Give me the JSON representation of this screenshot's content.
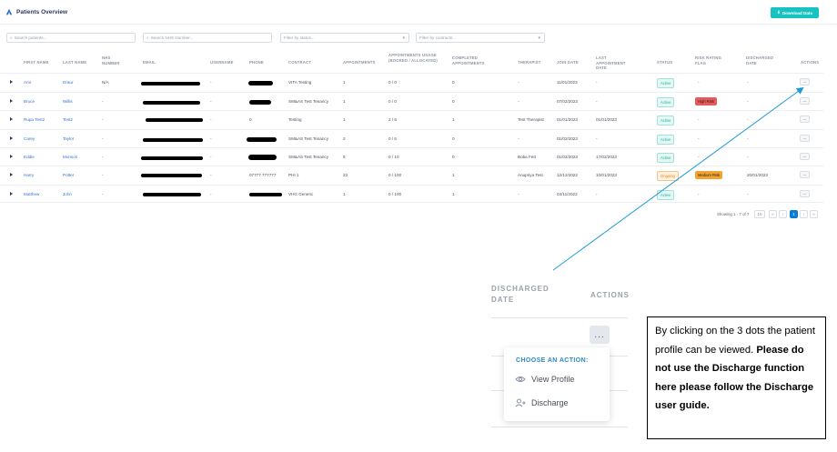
{
  "header": {
    "title": "Patients Overview",
    "download_label": "Download Data"
  },
  "filters": {
    "search_placeholder": "Search patients...",
    "nhs_placeholder": "Search NHS Number...",
    "status_placeholder": "Filter by status...",
    "contracts_placeholder": "Filter by contracts..."
  },
  "table": {
    "columns": {
      "first_name": "First Name",
      "last_name": "Last Name",
      "nhs_number": "NHS Number",
      "email": "Email",
      "username": "Username",
      "phone": "Phone",
      "contract": "Contract",
      "appointments": "Appointments",
      "appointments_usage": "Appointments Usage (Booked / Allocated)",
      "completed": "Completed Appointments",
      "therapist": "Therapist",
      "join_date": "Join Date",
      "last_appointment": "Last Appointment Date",
      "status": "Status",
      "risk_flag": "Risk Rating Flag",
      "discharged": "Discharged Date",
      "actions": "Actions"
    },
    "rows": [
      {
        "first": "Amr",
        "last": "Draur",
        "nhs": "N/A",
        "username": "-",
        "phone": "",
        "contract": "VITA Testing",
        "appts": "1",
        "usage": "0 / 0",
        "completed": "0",
        "therapist": "-",
        "join": "11/01/2023",
        "last_appt": "-",
        "status": "Active",
        "flag": "-",
        "discharged": "-",
        "actions": "..."
      },
      {
        "first": "Bruce",
        "last": "Willis",
        "nhs": "-",
        "username": "-",
        "phone": "",
        "contract": "SM&AS Test Tenancy",
        "appts": "1",
        "usage": "0 / 0",
        "completed": "0",
        "therapist": "-",
        "join": "07/02/2023",
        "last_appt": "-",
        "status": "Active",
        "flag": "High Risk",
        "discharged": "-",
        "actions": "..."
      },
      {
        "first": "Rupa Test2",
        "last": "Test2",
        "nhs": "-",
        "username": "-",
        "phone": "0",
        "contract": "Testing",
        "appts": "1",
        "usage": "2 / 6",
        "completed": "1",
        "therapist": "Test Therapist",
        "join": "01/01/2023",
        "last_appt": "01/01/2023",
        "status": "Active",
        "flag": "-",
        "discharged": "-",
        "actions": "..."
      },
      {
        "first": "Carey",
        "last": "Taylor",
        "nhs": "-",
        "username": "-",
        "phone": "",
        "contract": "SM&AS Test Tenancy",
        "appts": "2",
        "usage": "0 / 6",
        "completed": "0",
        "therapist": "-",
        "join": "01/02/2023",
        "last_appt": "-",
        "status": "Active",
        "flag": "-",
        "discharged": "-",
        "actions": "..."
      },
      {
        "first": "Eddie",
        "last": "Munson",
        "nhs": "-",
        "username": "-",
        "phone": "",
        "contract": "SM&AS Test Tenancy",
        "appts": "5",
        "usage": "0 / 10",
        "completed": "0",
        "therapist": "Boba Fett",
        "join": "01/02/2023",
        "last_appt": "17/02/2023",
        "status": "Active",
        "flag": "-",
        "discharged": "-",
        "actions": "..."
      },
      {
        "first": "Harry",
        "last": "Potter",
        "nhs": "-",
        "username": "-",
        "phone": "07777 777777",
        "contract": "PHI 1",
        "appts": "23",
        "usage": "0 / 100",
        "completed": "1",
        "therapist": "Anupriya Test",
        "join": "12/12/2022",
        "last_appt": "10/01/2023",
        "status": "Ongoing",
        "flag": "Medium Risk",
        "discharged": "20/01/2023",
        "actions": "..."
      },
      {
        "first": "Matthew",
        "last": "John",
        "nhs": "-",
        "username": "-",
        "phone": "",
        "contract": "VHG Generic",
        "appts": "1",
        "usage": "0 / 100",
        "completed": "1",
        "therapist": "-",
        "join": "04/11/2022",
        "last_appt": "-",
        "status": "Active",
        "flag": "-",
        "discharged": "-",
        "actions": "..."
      }
    ]
  },
  "pagination": {
    "summary": "Showing 1 - 7 of 7",
    "page_size": "10",
    "first": "«",
    "prev": "‹",
    "current": "1",
    "next": "›",
    "last": "»"
  },
  "zoom": {
    "discharged_line1": "DISCHARGED",
    "discharged_line2": "DATE",
    "actions": "ACTIONS",
    "dots": "...",
    "menu_title": "CHOOSE AN ACTION:",
    "view_profile": "View Profile",
    "discharge": "Discharge"
  },
  "callout": {
    "normal": "By clicking on the 3 dots the patient profile can be viewed.",
    "bold": "Please do not use the Discharge function here please follow the Discharge user guide."
  },
  "colors": {
    "accent": "#17c2c2",
    "link": "#3a6fd8",
    "arrow": "#1e9bd7",
    "pager_active": "#0a7bd4"
  }
}
